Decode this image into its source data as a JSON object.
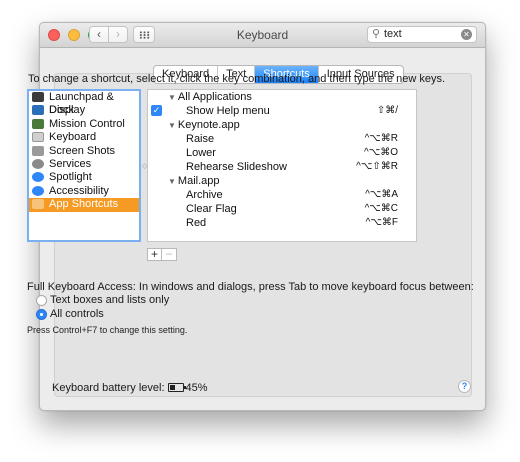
{
  "window": {
    "title": "Keyboard"
  },
  "search": {
    "value": "text"
  },
  "tabs": [
    {
      "label": "Keyboard",
      "active": false
    },
    {
      "label": "Text",
      "active": false
    },
    {
      "label": "Shortcuts",
      "active": true
    },
    {
      "label": "Input Sources",
      "active": false
    }
  ],
  "instructions": "To change a shortcut, select it, click the key combination, and then type the new keys.",
  "categories": [
    {
      "label": "Launchpad & Dock",
      "icon": "launchpad-icon",
      "color": "#3b3b3b",
      "selected": false
    },
    {
      "label": "Display",
      "icon": "display-icon",
      "color": "#2a6fb8",
      "selected": false
    },
    {
      "label": "Mission Control",
      "icon": "mission-control-icon",
      "color": "#4a7a3a",
      "selected": false
    },
    {
      "label": "Keyboard",
      "icon": "keyboard-icon",
      "color": "#cfcfcf",
      "selected": false
    },
    {
      "label": "Screen Shots",
      "icon": "screenshot-icon",
      "color": "#9a9a9a",
      "selected": false
    },
    {
      "label": "Services",
      "icon": "gear-icon",
      "color": "#8a8a8a",
      "selected": false
    },
    {
      "label": "Spotlight",
      "icon": "spotlight-icon",
      "color": "#2f86f6",
      "selected": false
    },
    {
      "label": "Accessibility",
      "icon": "accessibility-icon",
      "color": "#2f86f6",
      "selected": false
    },
    {
      "label": "App Shortcuts",
      "icon": "app-shortcuts-icon",
      "color": "#f59a23",
      "selected": true
    }
  ],
  "shortcuts": [
    {
      "type": "group",
      "label": "All Applications"
    },
    {
      "type": "item",
      "label": "Show Help menu",
      "keys": "⇧⌘/",
      "checked": true
    },
    {
      "type": "group",
      "label": "Keynote.app"
    },
    {
      "type": "item",
      "label": "Raise",
      "keys": "^⌥⌘R"
    },
    {
      "type": "item",
      "label": "Lower",
      "keys": "^⌥⌘O"
    },
    {
      "type": "item",
      "label": "Rehearse Slideshow",
      "keys": "^⌥⇧⌘R"
    },
    {
      "type": "group",
      "label": "Mail.app"
    },
    {
      "type": "item",
      "label": "Archive",
      "keys": "^⌥⌘A"
    },
    {
      "type": "item",
      "label": "Clear Flag",
      "keys": "^⌥⌘C"
    },
    {
      "type": "item",
      "label": "Red",
      "keys": "^⌥⌘F"
    }
  ],
  "buttons": {
    "add": "+",
    "remove": "−"
  },
  "full_keyboard_access": {
    "label": "Full Keyboard Access: In windows and dialogs, press Tab to move keyboard focus between:",
    "options": [
      {
        "label": "Text boxes and lists only",
        "selected": false
      },
      {
        "label": "All controls",
        "selected": true
      }
    ],
    "note": "Press Control+F7 to change this setting."
  },
  "battery": {
    "label": "Keyboard battery level:",
    "level": "45%"
  },
  "help": "?"
}
